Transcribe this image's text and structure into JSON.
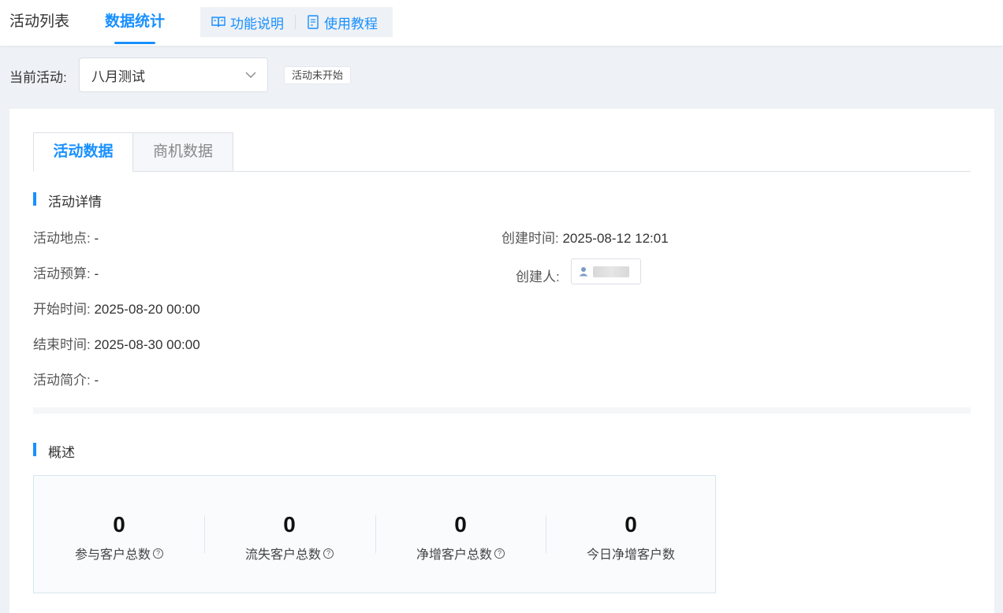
{
  "nav": {
    "tabs": [
      {
        "label": "活动列表"
      },
      {
        "label": "数据统计",
        "active": true
      }
    ],
    "help": {
      "feature_label": "功能说明",
      "tutorial_label": "使用教程"
    }
  },
  "activity_select": {
    "label": "当前活动:",
    "value": "八月测试",
    "status_badge": "活动未开始"
  },
  "panel": {
    "tabs": [
      {
        "label": "活动数据",
        "active": true
      },
      {
        "label": "商机数据"
      }
    ],
    "details": {
      "title": "活动详情",
      "location_label": "活动地点:",
      "location_value": "-",
      "budget_label": "活动预算:",
      "budget_value": "-",
      "start_label": "开始时间:",
      "start_value": "2025-08-20 00:00",
      "end_label": "结束时间:",
      "end_value": "2025-08-30 00:00",
      "intro_label": "活动简介:",
      "intro_value": "-",
      "created_label": "创建时间:",
      "created_value": "2025-08-12 12:01",
      "creator_label": "创建人:"
    },
    "overview": {
      "title": "概述",
      "stats": [
        {
          "value": "0",
          "label": "参与客户总数",
          "has_help": true
        },
        {
          "value": "0",
          "label": "流失客户总数",
          "has_help": true
        },
        {
          "value": "0",
          "label": "净增客户总数",
          "has_help": true
        },
        {
          "value": "0",
          "label": "今日净增客户数",
          "has_help": false
        }
      ],
      "help_glyph": "?"
    }
  },
  "colors": {
    "accent": "#1890ff",
    "background": "#eef1f5"
  }
}
